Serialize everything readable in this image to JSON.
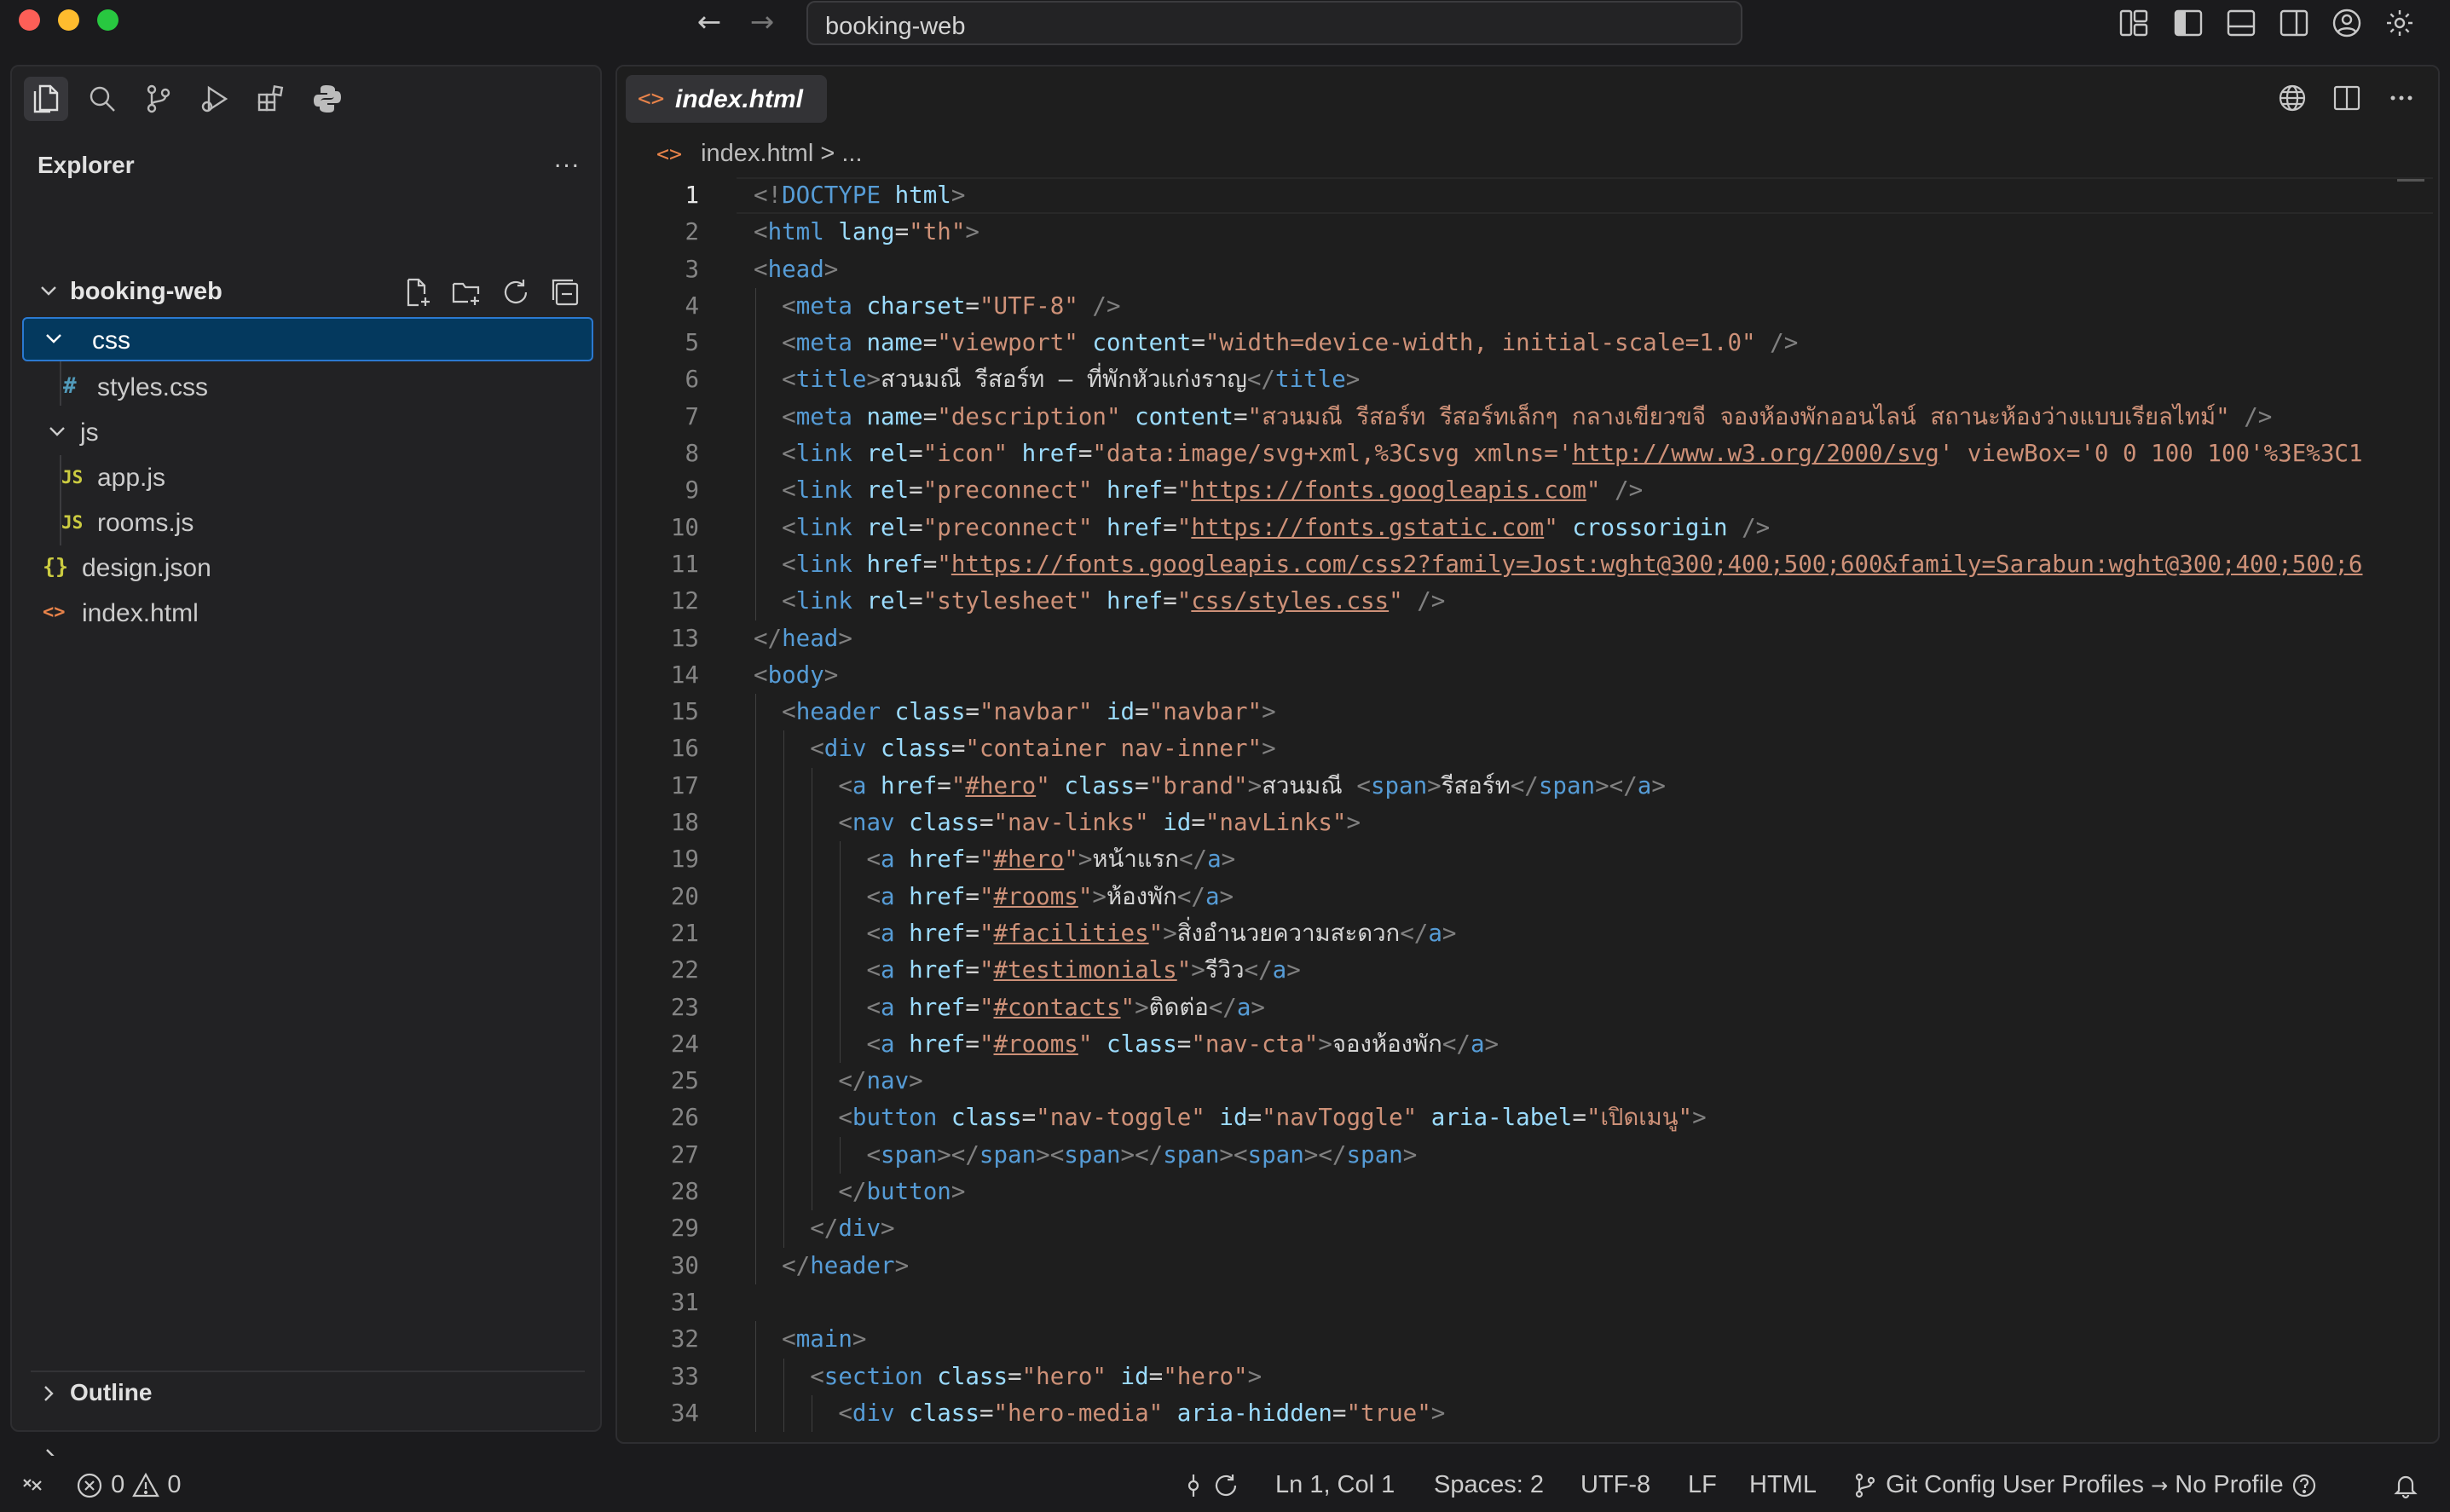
{
  "titlebar": {
    "search_text": "booking-web"
  },
  "sidebar": {
    "title": "Explorer",
    "more": "...",
    "root": "booking-web",
    "tree": [
      {
        "label": "css",
        "type": "folder",
        "icon": "chevron-down-icon"
      },
      {
        "label": "styles.css",
        "type": "file",
        "icon_glyph": "#",
        "icon_color": "#519aba"
      },
      {
        "label": "js",
        "type": "folder",
        "icon": "chevron-down-icon"
      },
      {
        "label": "app.js",
        "type": "file",
        "icon_glyph": "JS",
        "icon_color": "#cbcb41"
      },
      {
        "label": "rooms.js",
        "type": "file",
        "icon_glyph": "JS",
        "icon_color": "#cbcb41"
      },
      {
        "label": "design.json",
        "type": "file",
        "icon_glyph": "{}",
        "icon_color": "#cbcb41"
      },
      {
        "label": "index.html",
        "type": "file",
        "icon_glyph": "<>",
        "icon_color": "#e8834a"
      }
    ],
    "outline": "Outline"
  },
  "editor": {
    "tab_label": "index.html",
    "tab_icon": "<>",
    "breadcrumb_file": "index.html",
    "breadcrumb_rest": "> ..."
  },
  "code_lines": [
    [
      [
        "br",
        "<!"
      ],
      [
        "tg",
        "DOCTYPE"
      ],
      [
        "tx",
        " "
      ],
      [
        "at",
        "html"
      ],
      [
        "br",
        ">"
      ]
    ],
    [
      [
        "br",
        "<"
      ],
      [
        "tg",
        "html"
      ],
      [
        "tx",
        " "
      ],
      [
        "at",
        "lang"
      ],
      [
        "tx",
        "="
      ],
      [
        "st",
        "\"th\""
      ],
      [
        "br",
        ">"
      ]
    ],
    [
      [
        "br",
        "<"
      ],
      [
        "tg",
        "head"
      ],
      [
        "br",
        ">"
      ]
    ],
    [
      [
        "tx",
        "  "
      ],
      [
        "br",
        "<"
      ],
      [
        "tg",
        "meta"
      ],
      [
        "tx",
        " "
      ],
      [
        "at",
        "charset"
      ],
      [
        "tx",
        "="
      ],
      [
        "st",
        "\"UTF-8\""
      ],
      [
        "tx",
        " "
      ],
      [
        "br",
        "/>"
      ]
    ],
    [
      [
        "tx",
        "  "
      ],
      [
        "br",
        "<"
      ],
      [
        "tg",
        "meta"
      ],
      [
        "tx",
        " "
      ],
      [
        "at",
        "name"
      ],
      [
        "tx",
        "="
      ],
      [
        "st",
        "\"viewport\""
      ],
      [
        "tx",
        " "
      ],
      [
        "at",
        "content"
      ],
      [
        "tx",
        "="
      ],
      [
        "st",
        "\"width=device-width, initial-scale=1.0\""
      ],
      [
        "tx",
        " "
      ],
      [
        "br",
        "/>"
      ]
    ],
    [
      [
        "tx",
        "  "
      ],
      [
        "br",
        "<"
      ],
      [
        "tg",
        "title"
      ],
      [
        "br",
        ">"
      ],
      [
        "tx",
        "สวนมณี รีสอร์ท — ที่พักหัวแก่งราญ"
      ],
      [
        "br",
        "</"
      ],
      [
        "tg",
        "title"
      ],
      [
        "br",
        ">"
      ]
    ],
    [
      [
        "tx",
        "  "
      ],
      [
        "br",
        "<"
      ],
      [
        "tg",
        "meta"
      ],
      [
        "tx",
        " "
      ],
      [
        "at",
        "name"
      ],
      [
        "tx",
        "="
      ],
      [
        "st",
        "\"description\""
      ],
      [
        "tx",
        " "
      ],
      [
        "at",
        "content"
      ],
      [
        "tx",
        "="
      ],
      [
        "st",
        "\"สวนมณี รีสอร์ท รีสอร์ทเล็กๆ กลางเขียวขจี จองห้องพักออนไลน์ สถานะห้องว่างแบบเรียลไทม์\""
      ],
      [
        "tx",
        " "
      ],
      [
        "br",
        "/>"
      ]
    ],
    [
      [
        "tx",
        "  "
      ],
      [
        "br",
        "<"
      ],
      [
        "tg",
        "link"
      ],
      [
        "tx",
        " "
      ],
      [
        "at",
        "rel"
      ],
      [
        "tx",
        "="
      ],
      [
        "st",
        "\"icon\""
      ],
      [
        "tx",
        " "
      ],
      [
        "at",
        "href"
      ],
      [
        "tx",
        "="
      ],
      [
        "st",
        "\"data:image/svg+xml,%3Csvg xmlns='"
      ],
      [
        "lk",
        "http://www.w3.org/2000/svg"
      ],
      [
        "st",
        "' viewBox='0 0 100 100'%3E%3C1"
      ]
    ],
    [
      [
        "tx",
        "  "
      ],
      [
        "br",
        "<"
      ],
      [
        "tg",
        "link"
      ],
      [
        "tx",
        " "
      ],
      [
        "at",
        "rel"
      ],
      [
        "tx",
        "="
      ],
      [
        "st",
        "\"preconnect\""
      ],
      [
        "tx",
        " "
      ],
      [
        "at",
        "href"
      ],
      [
        "tx",
        "="
      ],
      [
        "st",
        "\""
      ],
      [
        "lk",
        "https://fonts.googleapis.com"
      ],
      [
        "st",
        "\""
      ],
      [
        "tx",
        " "
      ],
      [
        "br",
        "/>"
      ]
    ],
    [
      [
        "tx",
        "  "
      ],
      [
        "br",
        "<"
      ],
      [
        "tg",
        "link"
      ],
      [
        "tx",
        " "
      ],
      [
        "at",
        "rel"
      ],
      [
        "tx",
        "="
      ],
      [
        "st",
        "\"preconnect\""
      ],
      [
        "tx",
        " "
      ],
      [
        "at",
        "href"
      ],
      [
        "tx",
        "="
      ],
      [
        "st",
        "\""
      ],
      [
        "lk",
        "https://fonts.gstatic.com"
      ],
      [
        "st",
        "\""
      ],
      [
        "tx",
        " "
      ],
      [
        "at",
        "crossorigin"
      ],
      [
        "tx",
        " "
      ],
      [
        "br",
        "/>"
      ]
    ],
    [
      [
        "tx",
        "  "
      ],
      [
        "br",
        "<"
      ],
      [
        "tg",
        "link"
      ],
      [
        "tx",
        " "
      ],
      [
        "at",
        "href"
      ],
      [
        "tx",
        "="
      ],
      [
        "st",
        "\""
      ],
      [
        "lk",
        "https://fonts.googleapis.com/css2?family=Jost:wght@300;400;500;600&family=Sarabun:wght@300;400;500;6"
      ]
    ],
    [
      [
        "tx",
        "  "
      ],
      [
        "br",
        "<"
      ],
      [
        "tg",
        "link"
      ],
      [
        "tx",
        " "
      ],
      [
        "at",
        "rel"
      ],
      [
        "tx",
        "="
      ],
      [
        "st",
        "\"stylesheet\""
      ],
      [
        "tx",
        " "
      ],
      [
        "at",
        "href"
      ],
      [
        "tx",
        "="
      ],
      [
        "st",
        "\""
      ],
      [
        "lk",
        "css/styles.css"
      ],
      [
        "st",
        "\""
      ],
      [
        "tx",
        " "
      ],
      [
        "br",
        "/>"
      ]
    ],
    [
      [
        "br",
        "</"
      ],
      [
        "tg",
        "head"
      ],
      [
        "br",
        ">"
      ]
    ],
    [
      [
        "br",
        "<"
      ],
      [
        "tg",
        "body"
      ],
      [
        "br",
        ">"
      ]
    ],
    [
      [
        "tx",
        "  "
      ],
      [
        "br",
        "<"
      ],
      [
        "tg",
        "header"
      ],
      [
        "tx",
        " "
      ],
      [
        "at",
        "class"
      ],
      [
        "tx",
        "="
      ],
      [
        "st",
        "\"navbar\""
      ],
      [
        "tx",
        " "
      ],
      [
        "at",
        "id"
      ],
      [
        "tx",
        "="
      ],
      [
        "st",
        "\"navbar\""
      ],
      [
        "br",
        ">"
      ]
    ],
    [
      [
        "tx",
        "    "
      ],
      [
        "br",
        "<"
      ],
      [
        "tg",
        "div"
      ],
      [
        "tx",
        " "
      ],
      [
        "at",
        "class"
      ],
      [
        "tx",
        "="
      ],
      [
        "st",
        "\"container nav-inner\""
      ],
      [
        "br",
        ">"
      ]
    ],
    [
      [
        "tx",
        "      "
      ],
      [
        "br",
        "<"
      ],
      [
        "tg",
        "a"
      ],
      [
        "tx",
        " "
      ],
      [
        "at",
        "href"
      ],
      [
        "tx",
        "="
      ],
      [
        "st",
        "\""
      ],
      [
        "lk",
        "#hero"
      ],
      [
        "st",
        "\""
      ],
      [
        "tx",
        " "
      ],
      [
        "at",
        "class"
      ],
      [
        "tx",
        "="
      ],
      [
        "st",
        "\"brand\""
      ],
      [
        "br",
        ">"
      ],
      [
        "tx",
        "สวนมณี "
      ],
      [
        "br",
        "<"
      ],
      [
        "tg",
        "span"
      ],
      [
        "br",
        ">"
      ],
      [
        "tx",
        "รีสอร์ท"
      ],
      [
        "br",
        "</"
      ],
      [
        "tg",
        "span"
      ],
      [
        "br",
        "></"
      ],
      [
        "tg",
        "a"
      ],
      [
        "br",
        ">"
      ]
    ],
    [
      [
        "tx",
        "      "
      ],
      [
        "br",
        "<"
      ],
      [
        "tg",
        "nav"
      ],
      [
        "tx",
        " "
      ],
      [
        "at",
        "class"
      ],
      [
        "tx",
        "="
      ],
      [
        "st",
        "\"nav-links\""
      ],
      [
        "tx",
        " "
      ],
      [
        "at",
        "id"
      ],
      [
        "tx",
        "="
      ],
      [
        "st",
        "\"navLinks\""
      ],
      [
        "br",
        ">"
      ]
    ],
    [
      [
        "tx",
        "        "
      ],
      [
        "br",
        "<"
      ],
      [
        "tg",
        "a"
      ],
      [
        "tx",
        " "
      ],
      [
        "at",
        "href"
      ],
      [
        "tx",
        "="
      ],
      [
        "st",
        "\""
      ],
      [
        "lk",
        "#hero"
      ],
      [
        "st",
        "\""
      ],
      [
        "br",
        ">"
      ],
      [
        "tx",
        "หน้าแรก"
      ],
      [
        "br",
        "</"
      ],
      [
        "tg",
        "a"
      ],
      [
        "br",
        ">"
      ]
    ],
    [
      [
        "tx",
        "        "
      ],
      [
        "br",
        "<"
      ],
      [
        "tg",
        "a"
      ],
      [
        "tx",
        " "
      ],
      [
        "at",
        "href"
      ],
      [
        "tx",
        "="
      ],
      [
        "st",
        "\""
      ],
      [
        "lk",
        "#rooms"
      ],
      [
        "st",
        "\""
      ],
      [
        "br",
        ">"
      ],
      [
        "tx",
        "ห้องพัก"
      ],
      [
        "br",
        "</"
      ],
      [
        "tg",
        "a"
      ],
      [
        "br",
        ">"
      ]
    ],
    [
      [
        "tx",
        "        "
      ],
      [
        "br",
        "<"
      ],
      [
        "tg",
        "a"
      ],
      [
        "tx",
        " "
      ],
      [
        "at",
        "href"
      ],
      [
        "tx",
        "="
      ],
      [
        "st",
        "\""
      ],
      [
        "lk",
        "#facilities"
      ],
      [
        "st",
        "\""
      ],
      [
        "br",
        ">"
      ],
      [
        "tx",
        "สิ่งอำนวยความสะดวก"
      ],
      [
        "br",
        "</"
      ],
      [
        "tg",
        "a"
      ],
      [
        "br",
        ">"
      ]
    ],
    [
      [
        "tx",
        "        "
      ],
      [
        "br",
        "<"
      ],
      [
        "tg",
        "a"
      ],
      [
        "tx",
        " "
      ],
      [
        "at",
        "href"
      ],
      [
        "tx",
        "="
      ],
      [
        "st",
        "\""
      ],
      [
        "lk",
        "#testimonials"
      ],
      [
        "st",
        "\""
      ],
      [
        "br",
        ">"
      ],
      [
        "tx",
        "รีวิว"
      ],
      [
        "br",
        "</"
      ],
      [
        "tg",
        "a"
      ],
      [
        "br",
        ">"
      ]
    ],
    [
      [
        "tx",
        "        "
      ],
      [
        "br",
        "<"
      ],
      [
        "tg",
        "a"
      ],
      [
        "tx",
        " "
      ],
      [
        "at",
        "href"
      ],
      [
        "tx",
        "="
      ],
      [
        "st",
        "\""
      ],
      [
        "lk",
        "#contacts"
      ],
      [
        "st",
        "\""
      ],
      [
        "br",
        ">"
      ],
      [
        "tx",
        "ติดต่อ"
      ],
      [
        "br",
        "</"
      ],
      [
        "tg",
        "a"
      ],
      [
        "br",
        ">"
      ]
    ],
    [
      [
        "tx",
        "        "
      ],
      [
        "br",
        "<"
      ],
      [
        "tg",
        "a"
      ],
      [
        "tx",
        " "
      ],
      [
        "at",
        "href"
      ],
      [
        "tx",
        "="
      ],
      [
        "st",
        "\""
      ],
      [
        "lk",
        "#rooms"
      ],
      [
        "st",
        "\""
      ],
      [
        "tx",
        " "
      ],
      [
        "at",
        "class"
      ],
      [
        "tx",
        "="
      ],
      [
        "st",
        "\"nav-cta\""
      ],
      [
        "br",
        ">"
      ],
      [
        "tx",
        "จองห้องพัก"
      ],
      [
        "br",
        "</"
      ],
      [
        "tg",
        "a"
      ],
      [
        "br",
        ">"
      ]
    ],
    [
      [
        "tx",
        "      "
      ],
      [
        "br",
        "</"
      ],
      [
        "tg",
        "nav"
      ],
      [
        "br",
        ">"
      ]
    ],
    [
      [
        "tx",
        "      "
      ],
      [
        "br",
        "<"
      ],
      [
        "tg",
        "button"
      ],
      [
        "tx",
        " "
      ],
      [
        "at",
        "class"
      ],
      [
        "tx",
        "="
      ],
      [
        "st",
        "\"nav-toggle\""
      ],
      [
        "tx",
        " "
      ],
      [
        "at",
        "id"
      ],
      [
        "tx",
        "="
      ],
      [
        "st",
        "\"navToggle\""
      ],
      [
        "tx",
        " "
      ],
      [
        "at",
        "aria-label"
      ],
      [
        "tx",
        "="
      ],
      [
        "st",
        "\"เปิดเมนู\""
      ],
      [
        "br",
        ">"
      ]
    ],
    [
      [
        "tx",
        "        "
      ],
      [
        "br",
        "<"
      ],
      [
        "tg",
        "span"
      ],
      [
        "br",
        "></"
      ],
      [
        "tg",
        "span"
      ],
      [
        "br",
        "><"
      ],
      [
        "tg",
        "span"
      ],
      [
        "br",
        "></"
      ],
      [
        "tg",
        "span"
      ],
      [
        "br",
        "><"
      ],
      [
        "tg",
        "span"
      ],
      [
        "br",
        "></"
      ],
      [
        "tg",
        "span"
      ],
      [
        "br",
        ">"
      ]
    ],
    [
      [
        "tx",
        "      "
      ],
      [
        "br",
        "</"
      ],
      [
        "tg",
        "button"
      ],
      [
        "br",
        ">"
      ]
    ],
    [
      [
        "tx",
        "    "
      ],
      [
        "br",
        "</"
      ],
      [
        "tg",
        "div"
      ],
      [
        "br",
        ">"
      ]
    ],
    [
      [
        "tx",
        "  "
      ],
      [
        "br",
        "</"
      ],
      [
        "tg",
        "header"
      ],
      [
        "br",
        ">"
      ]
    ],
    [],
    [
      [
        "tx",
        "  "
      ],
      [
        "br",
        "<"
      ],
      [
        "tg",
        "main"
      ],
      [
        "br",
        ">"
      ]
    ],
    [
      [
        "tx",
        "    "
      ],
      [
        "br",
        "<"
      ],
      [
        "tg",
        "section"
      ],
      [
        "tx",
        " "
      ],
      [
        "at",
        "class"
      ],
      [
        "tx",
        "="
      ],
      [
        "st",
        "\"hero\""
      ],
      [
        "tx",
        " "
      ],
      [
        "at",
        "id"
      ],
      [
        "tx",
        "="
      ],
      [
        "st",
        "\"hero\""
      ],
      [
        "br",
        ">"
      ]
    ],
    [
      [
        "tx",
        "      "
      ],
      [
        "br",
        "<"
      ],
      [
        "tg",
        "div"
      ],
      [
        "tx",
        " "
      ],
      [
        "at",
        "class"
      ],
      [
        "tx",
        "="
      ],
      [
        "st",
        "\"hero-media\""
      ],
      [
        "tx",
        " "
      ],
      [
        "at",
        "aria-hidden"
      ],
      [
        "tx",
        "="
      ],
      [
        "st",
        "\"true\""
      ],
      [
        "br",
        ">"
      ]
    ]
  ],
  "statusbar": {
    "errors": "0",
    "warnings": "0",
    "position": "Ln 1, Col 1",
    "spaces": "Spaces: 2",
    "encoding": "UTF-8",
    "eol": "LF",
    "language": "HTML",
    "git_profiles": "Git Config User Profiles",
    "arrow": "→",
    "profile": "No Profile"
  }
}
